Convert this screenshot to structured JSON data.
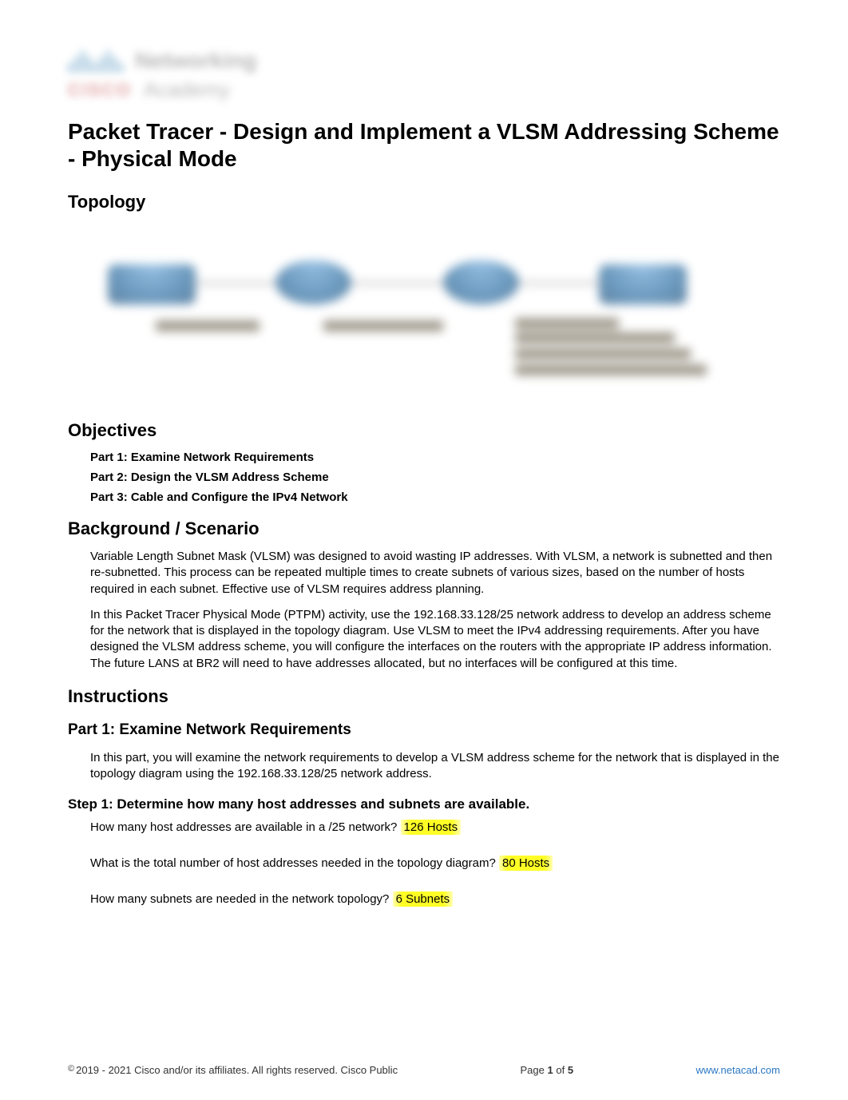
{
  "logo": {
    "text1": "Networking",
    "brand": "CISCO",
    "text2": "Academy"
  },
  "title": "Packet Tracer - Design and Implement a VLSM Addressing Scheme - Physical Mode",
  "sections": {
    "topology": "Topology",
    "objectives": "Objectives",
    "background": "Background / Scenario",
    "instructions": "Instructions"
  },
  "objectives": {
    "parts": [
      "Part 1: Examine Network Requirements",
      "Part 2: Design the VLSM Address Scheme",
      "Part 3: Cable and Configure the IPv4 Network"
    ]
  },
  "background": {
    "p1": "Variable Length Subnet Mask (VLSM) was designed to avoid wasting IP addresses. With VLSM, a network is subnetted and then re-subnetted. This process can be repeated multiple times to create subnets of various sizes, based on the number of hosts required in each subnet. Effective use of VLSM requires address planning.",
    "p2": "In this Packet Tracer Physical Mode (PTPM) activity, use the 192.168.33.128/25 network address to develop an address scheme for the network that is displayed in the topology diagram. Use VLSM to meet the IPv4 addressing requirements. After you have designed the VLSM address scheme, you will configure the interfaces on the routers with the appropriate IP address information. The future LANS at BR2 will need to have addresses allocated, but no interfaces will be configured at this time."
  },
  "part1": {
    "heading": "Part 1: Examine Network Requirements",
    "intro": "In this part, you will examine the network requirements to develop a VLSM address scheme for the network that is displayed in the topology diagram using the 192.168.33.128/25 network address.",
    "step1": {
      "heading": "Step 1: Determine how many host addresses and subnets are available.",
      "q1": "How many host addresses are available in a /25 network?",
      "a1": "126 Hosts",
      "q2": "What is the total number of host addresses needed in the topology diagram?",
      "a2": "80 Hosts",
      "q3": "How many subnets are needed in the network topology?",
      "a3": "6 Subnets"
    }
  },
  "footer": {
    "copyright": "2019 - 2021 Cisco and/or its affiliates. All rights reserved. Cisco Public",
    "page_prefix": "Page ",
    "page_current": "1",
    "page_sep": " of ",
    "page_total": "5",
    "url": "www.netacad.com"
  }
}
